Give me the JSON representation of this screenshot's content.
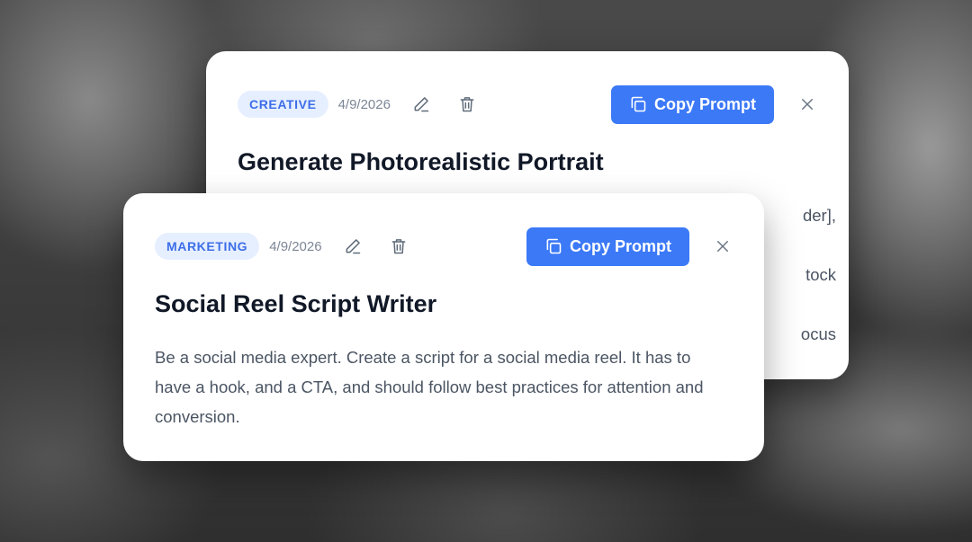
{
  "back_card": {
    "category": "CREATIVE",
    "date": "4/9/2026",
    "copy_label": "Copy Prompt",
    "title": "Generate Photorealistic Portrait",
    "visible_fragments": [
      "der],",
      "tock",
      "ocus"
    ]
  },
  "front_card": {
    "category": "MARKETING",
    "date": "4/9/2026",
    "copy_label": "Copy Prompt",
    "title": "Social Reel Script Writer",
    "description": "Be a social media expert. Create a script for a social media reel. It has to have a hook, and a CTA, and should follow best practices for attention and conversion."
  },
  "icons": {
    "edit": "pencil-icon",
    "delete": "trash-icon",
    "copy": "copy-icon",
    "close": "close-icon"
  },
  "colors": {
    "accent": "#3b79f7",
    "badge_bg": "#e6efff",
    "badge_text": "#3d6ee8",
    "title": "#111827",
    "body": "#4b5563"
  }
}
